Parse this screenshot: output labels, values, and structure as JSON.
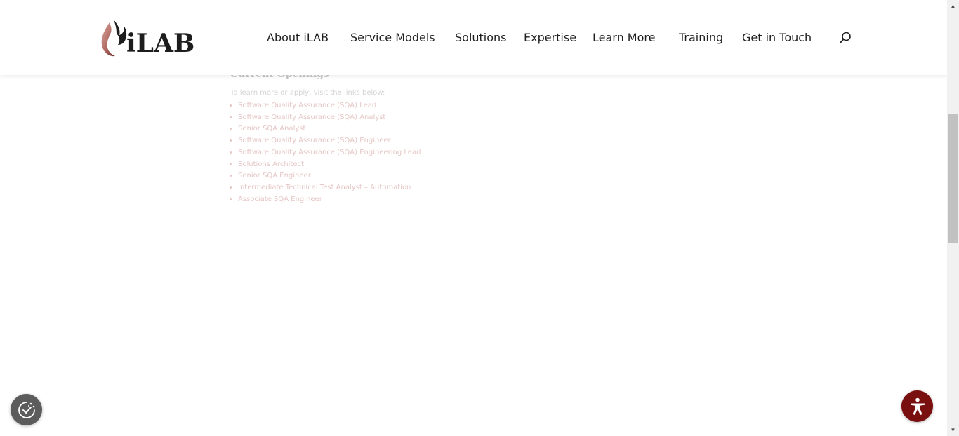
{
  "header": {
    "logo_text": "iLAB",
    "nav": [
      {
        "label": "About iLAB"
      },
      {
        "label": "Service Models"
      },
      {
        "label": "Solutions"
      },
      {
        "label": "Expertise"
      },
      {
        "label": "Learn More"
      },
      {
        "label": "Training"
      },
      {
        "label": "Get in Touch"
      }
    ],
    "search_icon": "search-icon"
  },
  "content": {
    "title": "Current Openings",
    "intro": "To learn more or apply, visit the links below:",
    "openings": [
      "Software Quality Assurance (SQA) Lead",
      "Software Quality Assurance (SQA) Analyst",
      "Senior SQA Analyst",
      "Software Quality Assurance (SQA) Engineer",
      "Software Quality Assurance (SQA) Engineering Lead",
      "Solutions Architect",
      "Senior SQA Engineer",
      "Intermediate Technical Test Analyst – Automation",
      "Associate SQA Engineer"
    ]
  },
  "floating": {
    "consent_icon": "cookie-consent-icon",
    "accessibility_icon": "accessibility-icon"
  },
  "colors": {
    "accent": "#7a0f0f",
    "link": "#a0312f",
    "nav_text": "#1f1f1f",
    "consent_bg": "#5c5c5c"
  }
}
